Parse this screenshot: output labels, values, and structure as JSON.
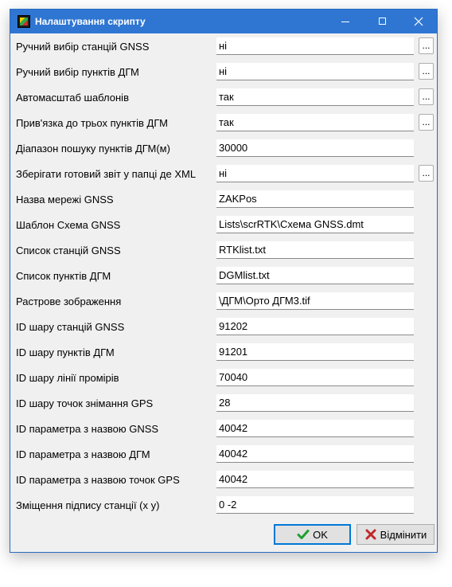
{
  "window": {
    "title": "Налаштування скрипту",
    "minimize_icon": "minimize-icon",
    "maximize_icon": "maximize-icon",
    "close_icon": "close-icon"
  },
  "fields": [
    {
      "label": "Ручний вибір станцій GNSS",
      "value": "ні",
      "has_browse": true
    },
    {
      "label": "Ручний вибір пунктів ДГМ",
      "value": "ні",
      "has_browse": true
    },
    {
      "label": "Автомасштаб шаблонів",
      "value": "так",
      "has_browse": true
    },
    {
      "label": "Прив'язка до трьох пунктів ДГМ",
      "value": "так",
      "has_browse": true
    },
    {
      "label": "Діапазон пошуку пунктів ДГМ(м)",
      "value": "30000",
      "has_browse": false
    },
    {
      "label": "Зберігати готовий звіт у папці де XML",
      "value": "ні",
      "has_browse": true
    },
    {
      "label": "Назва мережі GNSS",
      "value": "ZAKPos",
      "has_browse": false
    },
    {
      "label": "Шаблон Схема GNSS",
      "value": "Lists\\scrRTK\\Схема GNSS.dmt",
      "has_browse": false
    },
    {
      "label": "Список станцій GNSS",
      "value": "RTKlist.txt",
      "has_browse": false
    },
    {
      "label": "Список пунктів ДГМ",
      "value": "DGMlist.txt",
      "has_browse": false
    },
    {
      "label": "Растрове зображення",
      "value": "\\ДГМ\\Орто ДГМ3.tif",
      "has_browse": false
    },
    {
      "label": "ID шару станцій GNSS",
      "value": "91202",
      "has_browse": false
    },
    {
      "label": "ID шару пунктів ДГМ",
      "value": "91201",
      "has_browse": false
    },
    {
      "label": "ID шару лінії промірів",
      "value": "70040",
      "has_browse": false
    },
    {
      "label": "ID шару точок знімання GPS",
      "value": "28",
      "has_browse": false
    },
    {
      "label": "ID параметра з назвою GNSS",
      "value": "40042",
      "has_browse": false
    },
    {
      "label": "ID параметра з назвою ДГМ",
      "value": "40042",
      "has_browse": false
    },
    {
      "label": "ID параметра з назвою точок GPS",
      "value": "40042",
      "has_browse": false
    },
    {
      "label": "Зміщення підпису станції (x y)",
      "value": "0 -2",
      "has_browse": false
    }
  ],
  "browse_label": "...",
  "buttons": {
    "ok_label": "OK",
    "ok_icon": "checkmark-icon",
    "cancel_label": "Відмінити",
    "cancel_icon": "x-icon"
  },
  "colors": {
    "titlebar": "#2f76d2",
    "ok_check": "#1e9e2e",
    "cancel_x": "#c0282a"
  }
}
